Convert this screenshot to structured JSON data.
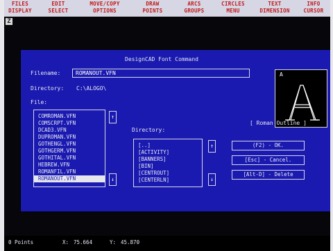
{
  "menu": [
    {
      "line1": "FILES",
      "line2": "DISPLAY"
    },
    {
      "line1": "EDIT",
      "line2": "SELECT"
    },
    {
      "line1": "MOVE/COPY",
      "line2": "OPTIONS"
    },
    {
      "line1": "DRAW",
      "line2": "POINTS"
    },
    {
      "line1": "ARCS",
      "line2": "GROUPS"
    },
    {
      "line1": "CIRCLES",
      "line2": "MENU"
    },
    {
      "line1": "TEXT",
      "line2": "DIMENSION"
    },
    {
      "line1": "INFO",
      "line2": "CURSOR"
    }
  ],
  "corner_icon": "Z",
  "dialog": {
    "title": "DesignCAD Font Command",
    "filename_label": "Filename:",
    "filename_value": "ROMANOUT.VFN",
    "directory_label": "Directory:",
    "directory_value": "C:\\ALOGO\\",
    "file_label": "File:",
    "files": [
      "COMROMAN.VFN",
      "COMSCRPT.VFN",
      "DCAD3.VFN",
      "DUPROMAN.VFN",
      "GOTHENGL.VFN",
      "GOTHGERM.VFN",
      "GOTHITAL.VFN",
      "HEBREW.VFN",
      "ROMANFIL.VFN",
      "ROMANOUT.VFN"
    ],
    "selected_file_index": 9,
    "dir_list_label": "Directory:",
    "directories": [
      "[..]",
      "[ACTIVITY]",
      "[BANNERS]",
      "[BIN]",
      "[CENTROUT]",
      "[CENTERLN]"
    ],
    "scroll_up": "↑",
    "scroll_down": "↓",
    "preview_char": "A",
    "preview_glyph": "A",
    "font_name": "[ Roman Outline ]",
    "ok_button": "(F2) - OK.",
    "cancel_button": "[Esc] - Cancel.",
    "delete_button": "[Alt-D] - Delete"
  },
  "status": {
    "mode": "0 Points",
    "x_label": "X:",
    "x_value": "75.664",
    "y_label": "Y:",
    "y_value": "45.870"
  },
  "colors": {
    "dialog_bg": "#1a1ab0",
    "menu_text": "#c01818",
    "menu_bg": "#d6d6e4"
  }
}
